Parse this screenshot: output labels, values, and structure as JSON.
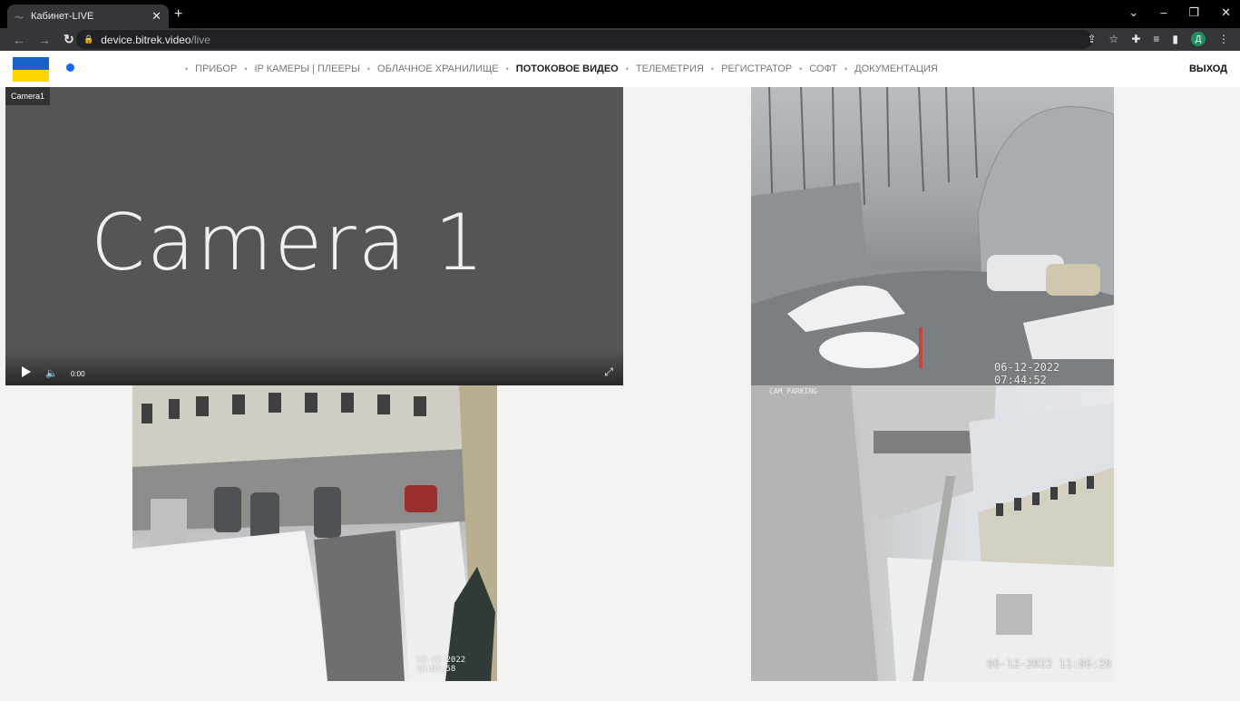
{
  "browser": {
    "tab_title": "Кабинет-LIVE",
    "url_host": "device.bitrek.video",
    "url_path": "/live",
    "profile_initial": "Д"
  },
  "nav": {
    "items": [
      {
        "label": "ПРИБОР",
        "active": false
      },
      {
        "label": "IP КАМЕРЫ | ПЛЕЕРЫ",
        "active": false
      },
      {
        "label": "ОБЛАЧНОЕ ХРАНИЛИЩЕ",
        "active": false
      },
      {
        "label": "ПОТОКОВОЕ ВИДЕО",
        "active": true
      },
      {
        "label": "ТЕЛЕМЕТРИЯ",
        "active": false
      },
      {
        "label": "РЕГИСТРАТОР",
        "active": false
      },
      {
        "label": "СОФТ",
        "active": false
      },
      {
        "label": "ДОКУМЕНТАЦИЯ",
        "active": false
      }
    ],
    "logout": "ВЫХОД"
  },
  "camera1": {
    "label": "Camera1",
    "placeholder_text": "Camera 1",
    "time": "0:00"
  },
  "camera2": {
    "timestamp": "06-12-2022 07:44:52"
  },
  "camera3": {
    "timestamp": "12-12-2022 16:05:58"
  },
  "camera4": {
    "name": "CAM_PARKING",
    "timestamp": "06-12-2022 11:06:20"
  },
  "colors": {
    "flag_blue": "#1663c7",
    "flag_yellow": "#ffd500",
    "status_dot": "#1466ff"
  }
}
